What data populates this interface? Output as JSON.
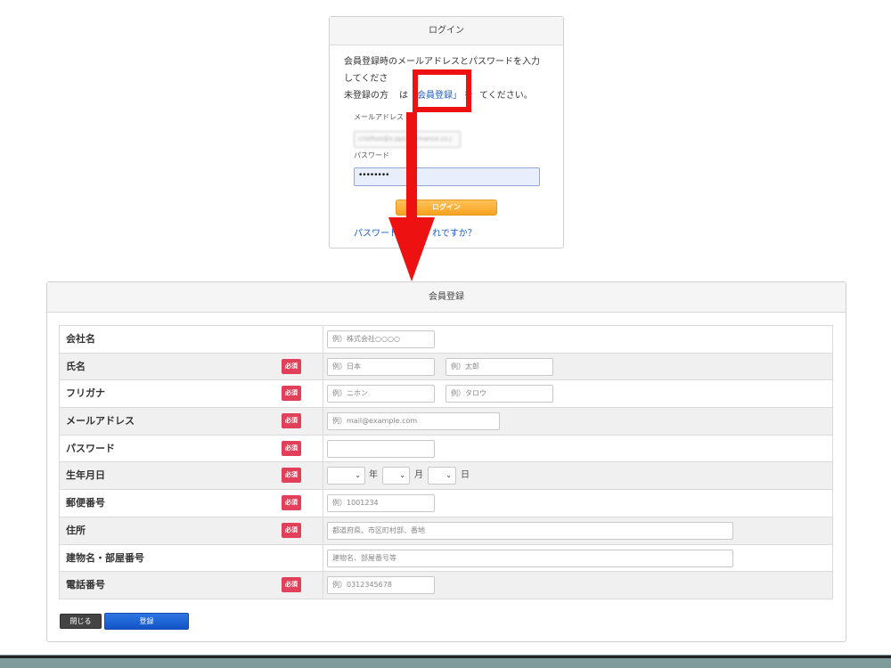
{
  "login": {
    "title": "ログイン",
    "desc_line1": "会員登録時のメールアドレスとパスワードを入力",
    "desc_line2": "してくださ",
    "desc_line2_tail": "。",
    "desc_line3_pre": "未登録の方",
    "desc_line3_mid": "は「",
    "register_link": "会員登録」",
    "desc_line3_post": "を",
    "desc_line3_end": "てください。",
    "email_label": "メールアドレス",
    "email_value": "cristhox@x.pperformance.co.j",
    "password_label": "パスワード",
    "password_value": "••••••••",
    "login_button": "ログイン",
    "forgot_link_pre": "パスワード",
    "forgot_link_post": "れですか？"
  },
  "registration": {
    "title": "会員登録",
    "required_badge": "必須",
    "rows": [
      {
        "label": "会社名",
        "required": false,
        "placeholders": [
          "例）株式会社○○○○"
        ]
      },
      {
        "label": "氏名",
        "required": true,
        "placeholders": [
          "例）日本",
          "例）太郎"
        ]
      },
      {
        "label": "フリガナ",
        "required": true,
        "placeholders": [
          "例）ニホン",
          "例）タロウ"
        ]
      },
      {
        "label": "メールアドレス",
        "required": true,
        "placeholders": [
          "例）mail@example.com"
        ]
      },
      {
        "label": "パスワード",
        "required": true,
        "placeholders": [
          ""
        ]
      },
      {
        "label": "生年月日",
        "required": true,
        "date_units": [
          "年",
          "月",
          "日"
        ]
      },
      {
        "label": "郵便番号",
        "required": true,
        "placeholders": [
          "例）1001234"
        ]
      },
      {
        "label": "住所",
        "required": true,
        "placeholders": [
          "都道府県、市区町村部、番地"
        ]
      },
      {
        "label": "建物名・部屋番号",
        "required": false,
        "placeholders": [
          "建物名、部屋番号等"
        ]
      },
      {
        "label": "電話番号",
        "required": true,
        "placeholders": [
          "例）0312345678"
        ]
      }
    ],
    "close_button": "閉じる",
    "submit_button": "登録"
  },
  "colors": {
    "highlight_red": "#ee1111",
    "login_orange": "#f6a21f",
    "register_blue": "#1354c8",
    "required_pink": "#e23f5a"
  },
  "icons": {
    "select_chevron": "chevron-down-icon",
    "annotation_arrow": "arrow-down-icon"
  }
}
